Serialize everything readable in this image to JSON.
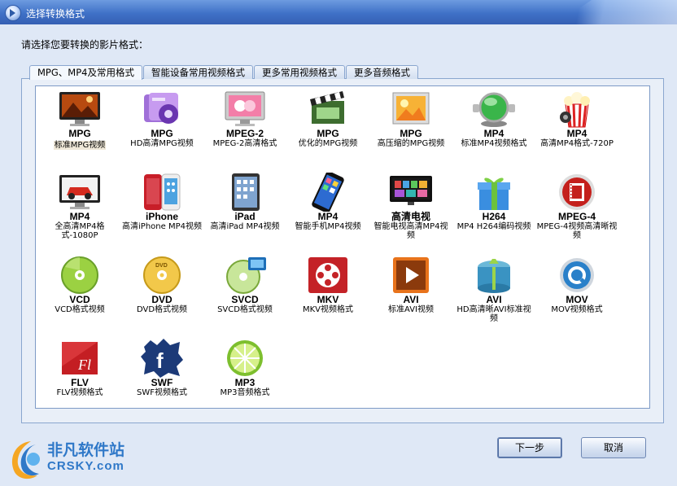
{
  "window": {
    "title": "选择转换格式"
  },
  "prompt": "请选择您要转换的影片格式：",
  "tabs": [
    {
      "label": "MPG、MP4及常用格式"
    },
    {
      "label": "智能设备常用视频格式"
    },
    {
      "label": "更多常用视频格式"
    },
    {
      "label": "更多音频格式"
    }
  ],
  "formats": [
    {
      "code": "MPG",
      "desc": "标准MPG视频",
      "icon": "landscape-monitor-icon"
    },
    {
      "code": "MPG",
      "desc": "HD高清MPG视频",
      "icon": "purple-film-icon"
    },
    {
      "code": "MPEG-2",
      "desc": "MPEG-2高清格式",
      "icon": "pink-monitor-icon"
    },
    {
      "code": "MPG",
      "desc": "优化的MPG视频",
      "icon": "film-clapper-icon"
    },
    {
      "code": "MPG",
      "desc": "高压缩的MPG视频",
      "icon": "photo-frame-icon"
    },
    {
      "code": "MP4",
      "desc": "标准MP4视频格式",
      "icon": "green-globe-icon"
    },
    {
      "code": "MP4",
      "desc": "高清MP4格式-720P",
      "icon": "popcorn-icon"
    },
    {
      "code": "MP4",
      "desc": "全高清MP4格式-1080P",
      "icon": "car-monitor-icon"
    },
    {
      "code": "iPhone",
      "desc": "高清iPhone MP4视频",
      "icon": "iphone-icon"
    },
    {
      "code": "iPad",
      "desc": "高清iPad MP4视频",
      "icon": "ipad-icon"
    },
    {
      "code": "MP4",
      "desc": "智能手机MP4视频",
      "icon": "smartphone-icon"
    },
    {
      "code": "高清电视",
      "desc": "智能电视高清MP4视频",
      "icon": "smart-tv-icon"
    },
    {
      "code": "H264",
      "desc": "MP4 H264编码视频",
      "icon": "gift-box-icon"
    },
    {
      "code": "MPEG-4",
      "desc": "MPEG-4视频高清晰视频",
      "icon": "film-button-icon"
    },
    {
      "code": "VCD",
      "desc": "VCD格式视频",
      "icon": "vcd-disc-icon"
    },
    {
      "code": "DVD",
      "desc": "DVD格式视频",
      "icon": "dvd-disc-icon"
    },
    {
      "code": "SVCD",
      "desc": "SVCD格式视频",
      "icon": "svcd-disc-icon"
    },
    {
      "code": "MKV",
      "desc": "MKV视频格式",
      "icon": "mkv-reel-icon"
    },
    {
      "code": "AVI",
      "desc": "标准AVI视频",
      "icon": "avi-play-icon"
    },
    {
      "code": "AVI",
      "desc": "HD高清晰AVI标准视频",
      "icon": "avi-box-icon"
    },
    {
      "code": "MOV",
      "desc": "MOV视频格式",
      "icon": "quicktime-icon"
    },
    {
      "code": "FLV",
      "desc": "FLV视频格式",
      "icon": "flash-icon"
    },
    {
      "code": "SWF",
      "desc": "SWF视频格式",
      "icon": "facebook-swf-icon"
    },
    {
      "code": "MP3",
      "desc": "MP3音频格式",
      "icon": "lime-icon"
    }
  ],
  "buttons": {
    "next": "下一步",
    "cancel": "取消"
  },
  "watermark": {
    "line1": "非凡软件站",
    "line2": "CRSKY.com"
  },
  "colors": {
    "titlebar": "#3f71c7",
    "background": "#dfe8f6",
    "panel_border": "#8aa6cf",
    "watermark": "#2f78c8"
  }
}
